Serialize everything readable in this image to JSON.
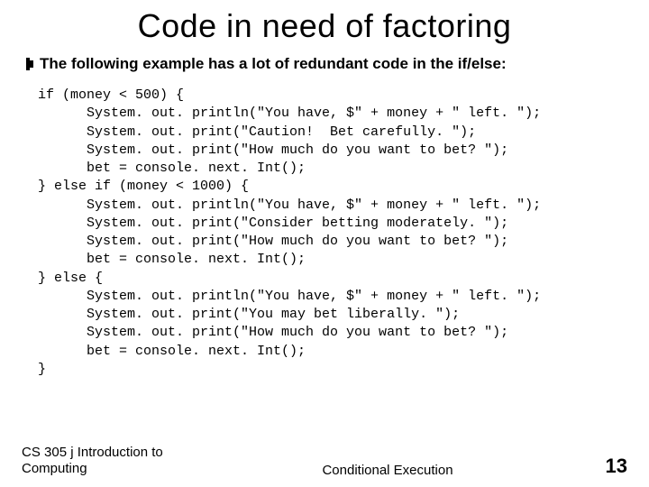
{
  "title": "Code in need of factoring",
  "bullet": "The following example has a lot of redundant code in the if/else:",
  "code": "if (money < 500) {\n      System. out. println(\"You have, $\" + money + \" left. \");\n      System. out. print(\"Caution!  Bet carefully. \");\n      System. out. print(\"How much do you want to bet? \");\n      bet = console. next. Int();\n} else if (money < 1000) {\n      System. out. println(\"You have, $\" + money + \" left. \");\n      System. out. print(\"Consider betting moderately. \");\n      System. out. print(\"How much do you want to bet? \");\n      bet = console. next. Int();\n} else {\n      System. out. println(\"You have, $\" + money + \" left. \");\n      System. out. print(\"You may bet liberally. \");\n      System. out. print(\"How much do you want to bet? \");\n      bet = console. next. Int();\n}",
  "footer": {
    "left": "CS 305 j Introduction to Computing",
    "center": "Conditional Execution",
    "page": "13"
  }
}
